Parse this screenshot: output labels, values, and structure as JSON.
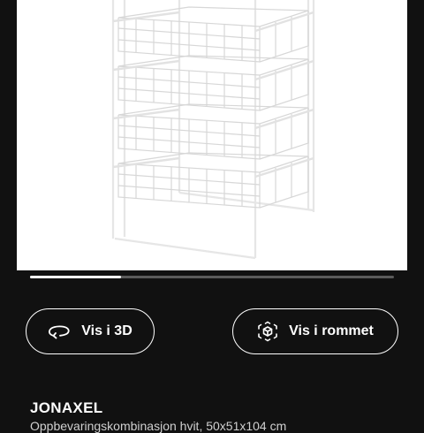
{
  "product": {
    "image_alt": "White wire basket frame with five drawers",
    "name": "JONAXEL",
    "description": "Oppbevaringskombinasjon hvit, 50x51x104 cm"
  },
  "carousel": {
    "progress": 0.25
  },
  "actions": {
    "view_3d_label": "Vis i 3D",
    "view_in_room_label": "Vis i rommet"
  },
  "icons": {
    "view_3d": "rotate-3d-icon",
    "view_in_room": "ar-cube-icon"
  },
  "colors": {
    "background": "#111111",
    "accent": "#ffffff"
  }
}
